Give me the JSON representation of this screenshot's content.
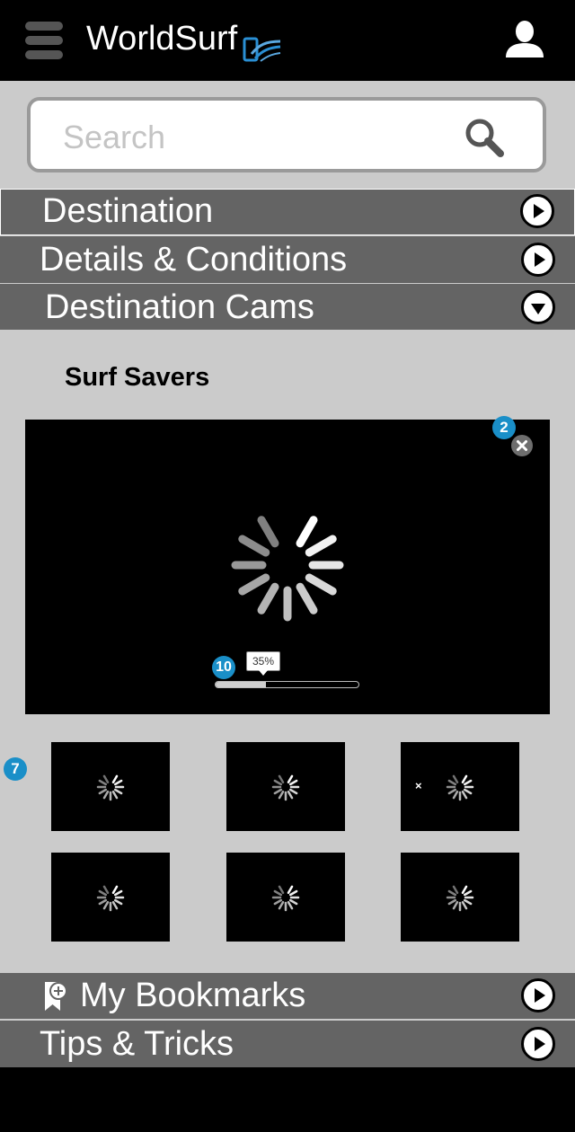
{
  "header": {
    "title": "WorldSurf",
    "menu_icon": "hamburger-menu-icon",
    "logo_icon": "phone-wave-logo-icon",
    "user_icon": "user-profile-icon",
    "logo_colors": [
      "#2a8fd4",
      "#5aa8e0"
    ]
  },
  "search": {
    "placeholder": "Search",
    "value": "",
    "icon": "search-icon"
  },
  "accordion": {
    "destination": {
      "label": "Destination",
      "state": "collapsed"
    },
    "details": {
      "label": "Details & Conditions",
      "state": "collapsed"
    },
    "cams": {
      "label": "Destination Cams",
      "state": "expanded"
    },
    "bookmarks": {
      "label": "My Bookmarks",
      "state": "collapsed",
      "icon": "bookmark-add-icon"
    },
    "tips": {
      "label": "Tips & Tricks",
      "state": "collapsed"
    }
  },
  "cams_section": {
    "title": "Surf Savers",
    "main_cam": {
      "badge": "2",
      "close_icon": "close-icon",
      "loading_icon": "loading-spinner-icon",
      "progress": {
        "badge": "10",
        "label": "35%",
        "value": 0.35
      }
    },
    "thumbnails_badge": "7",
    "thumbnails": [
      {
        "id": "thumb-1",
        "loading": true,
        "mark": ""
      },
      {
        "id": "thumb-2",
        "loading": true,
        "mark": ""
      },
      {
        "id": "thumb-3",
        "loading": true,
        "mark": "×"
      },
      {
        "id": "thumb-4",
        "loading": true,
        "mark": ""
      },
      {
        "id": "thumb-5",
        "loading": true,
        "mark": ""
      },
      {
        "id": "thumb-6",
        "loading": true,
        "mark": ""
      }
    ]
  },
  "colors": {
    "header_bg": "#000000",
    "content_bg": "#cbcbcb",
    "accordion_bg": "#646464",
    "badge": "#1a8fc8"
  }
}
